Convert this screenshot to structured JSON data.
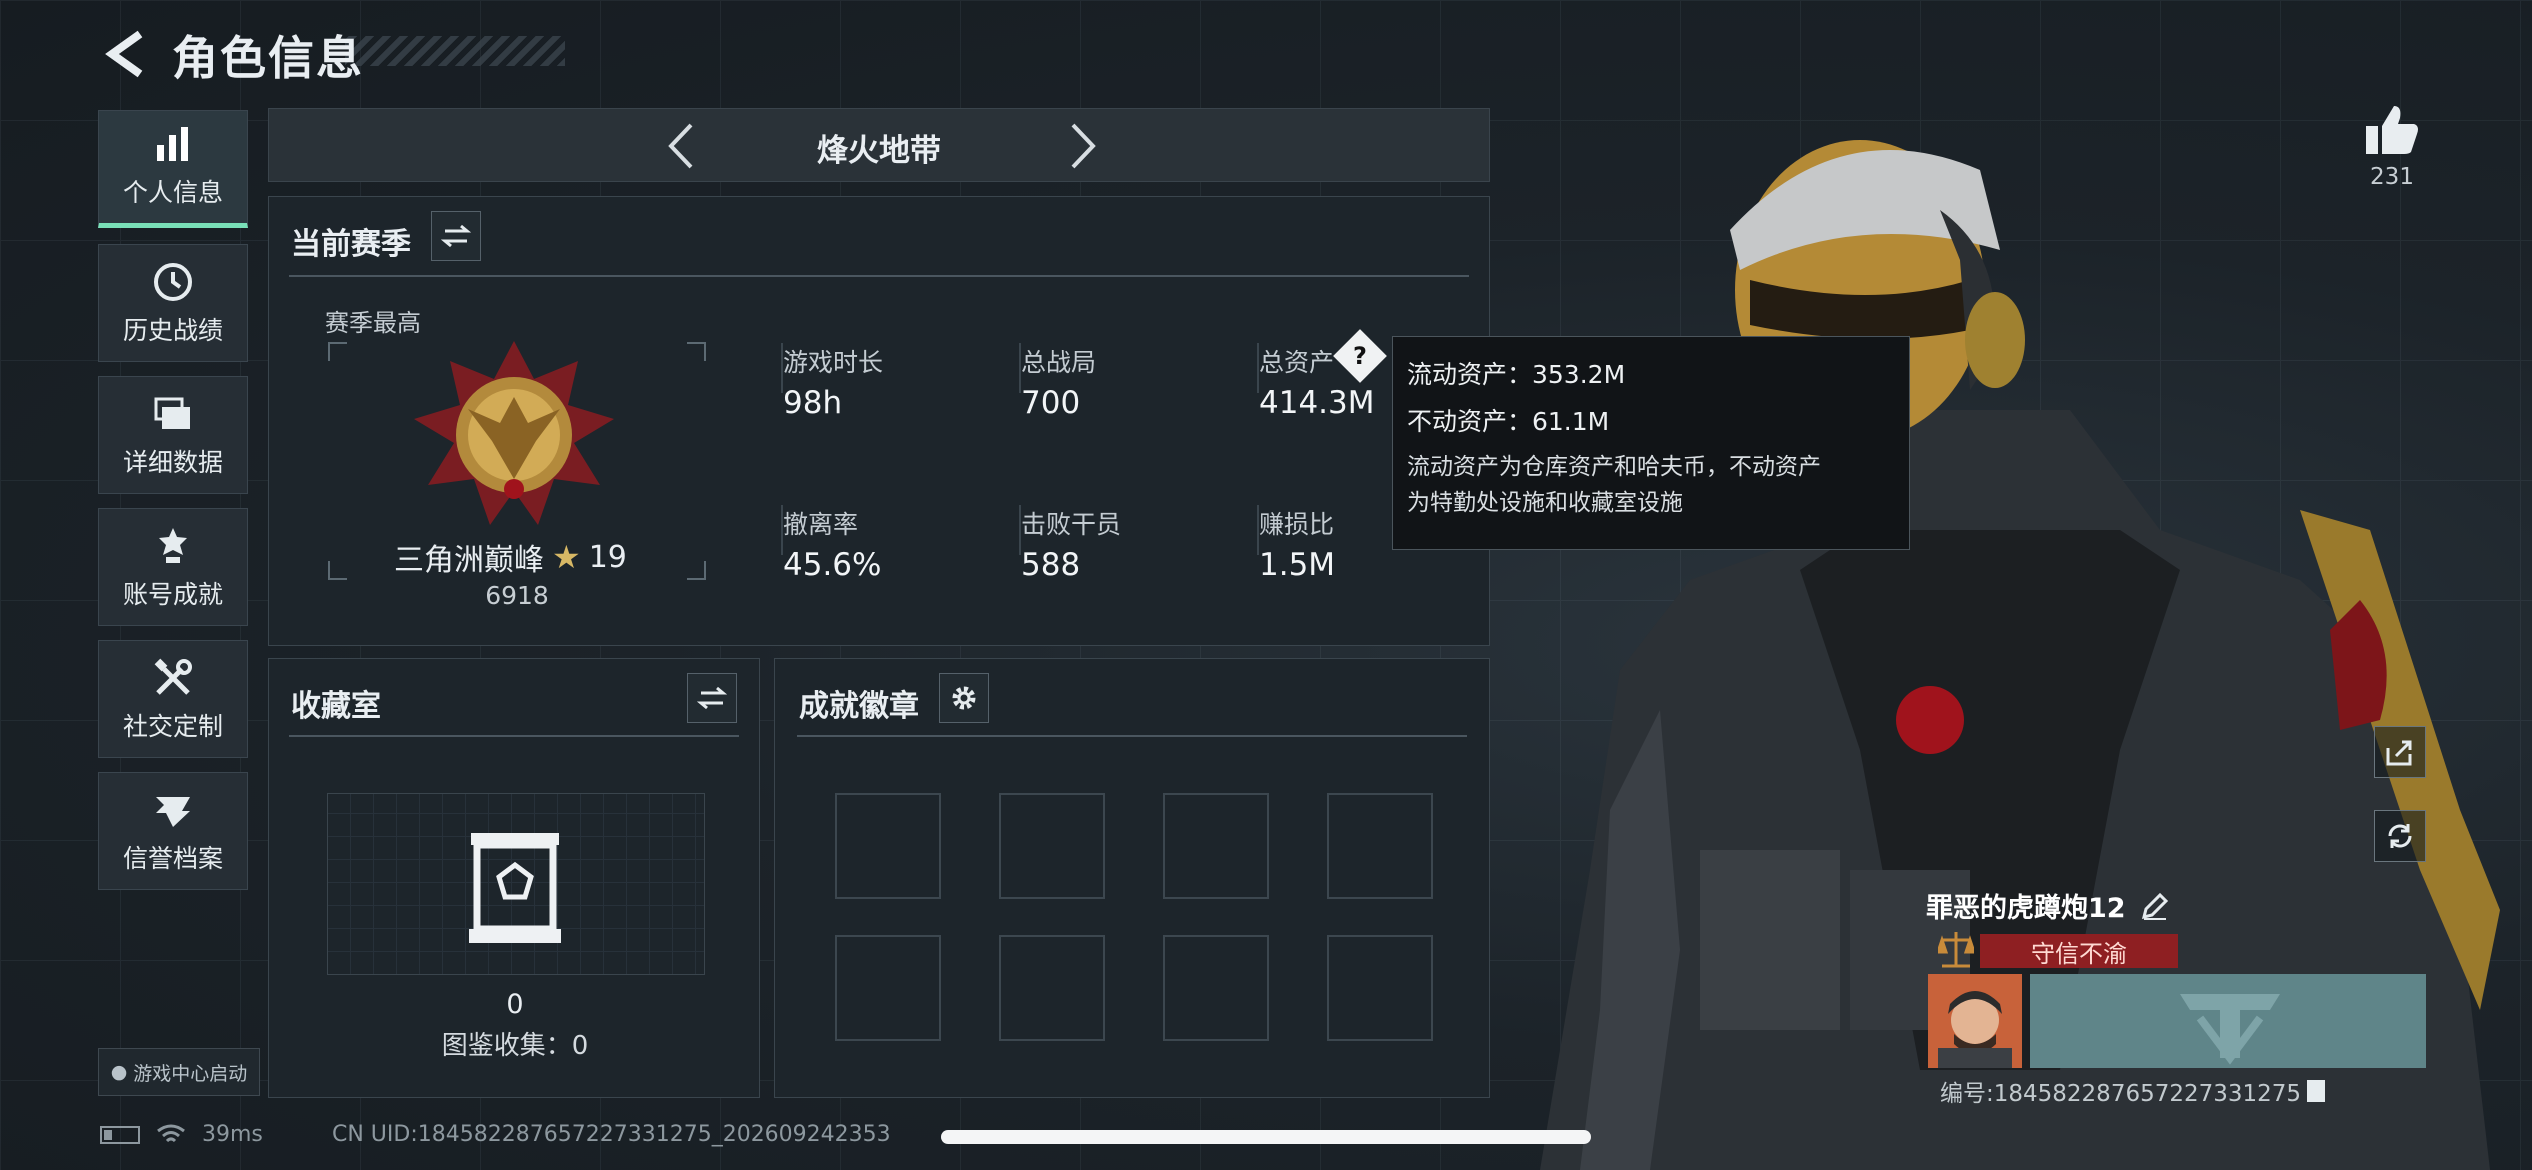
{
  "header": {
    "title": "角色信息"
  },
  "sidebar": {
    "items": [
      {
        "label": "个人信息",
        "icon": "bar-chart-icon",
        "active": true
      },
      {
        "label": "历史战绩",
        "icon": "clock-icon",
        "active": false
      },
      {
        "label": "详细数据",
        "icon": "folders-icon",
        "active": false
      },
      {
        "label": "账号成就",
        "icon": "medal-icon",
        "active": false
      },
      {
        "label": "社交定制",
        "icon": "tools-icon",
        "active": false
      },
      {
        "label": "信誉档案",
        "icon": "emblem-icon",
        "active": false
      }
    ],
    "launch_label": "游戏中心启动"
  },
  "mode": {
    "title": "烽火地带"
  },
  "season": {
    "title": "当前赛季",
    "best_label": "赛季最高",
    "rank_name": "三角洲巅峰",
    "rank_stars": "19",
    "rank_points": "6918",
    "stats": [
      {
        "label": "游戏时长",
        "value": "98h"
      },
      {
        "label": "总战局",
        "value": "700"
      },
      {
        "label": "总资产",
        "value": "414.3M"
      },
      {
        "label": "撤离率",
        "value": "45.6%"
      },
      {
        "label": "击败干员",
        "value": "588"
      },
      {
        "label": "赚损比",
        "value": "1.5M"
      }
    ]
  },
  "tooltip": {
    "liquid": "流动资产：353.2M",
    "fixed": "不动资产：61.1M",
    "desc_line1": "流动资产为仓库资产和哈夫币，不动资产",
    "desc_line2": "为特勤处设施和收藏室设施"
  },
  "collection": {
    "title": "收藏室",
    "count": "0",
    "codex": "图鉴收集：0"
  },
  "badges": {
    "title": "成就徽章",
    "slots": 8
  },
  "profile": {
    "likes": "231",
    "name": "罪恶的虎蹲炮12",
    "reputation": "守信不渝",
    "id_label": "编号:184582287657227331275"
  },
  "status": {
    "ping": "39ms",
    "cn_uid": "CN UID:184582287657227331275_202609242353"
  }
}
